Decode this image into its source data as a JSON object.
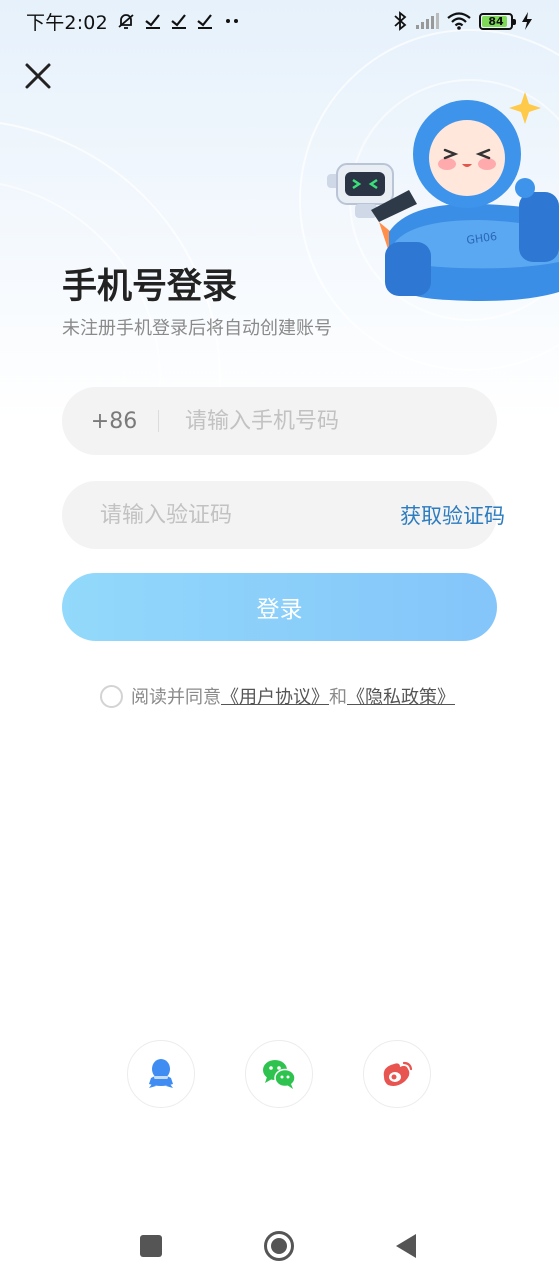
{
  "status_bar": {
    "time": "下午2:02",
    "battery_level": "84",
    "icons": [
      "mute-bell-icon",
      "check-icon",
      "check-icon",
      "check-icon",
      "more-dots-icon",
      "bluetooth-icon",
      "signal-icon",
      "wifi-icon",
      "battery-icon",
      "charging-icon"
    ]
  },
  "header": {
    "close_icon": "close-icon",
    "title": "手机号登录",
    "subtitle": "未注册手机登录后将自动创建账号"
  },
  "form": {
    "country_code": "+86",
    "phone_placeholder": "请输入手机号码",
    "phone_value": "",
    "code_placeholder": "请输入验证码",
    "code_value": "",
    "get_code_label": "获取验证码",
    "login_label": "登录"
  },
  "agreement": {
    "prefix": "阅读并同意",
    "user_agreement": "《用户协议》",
    "and": "和",
    "privacy_policy": "《隐私政策》",
    "checked": false
  },
  "third_party": [
    {
      "name": "qq",
      "icon": "qq-icon",
      "color": "#3f8cf2"
    },
    {
      "name": "wechat",
      "icon": "wechat-icon",
      "color": "#2ec24f"
    },
    {
      "name": "weibo",
      "icon": "weibo-icon",
      "color": "#e8544f"
    }
  ],
  "nav_bar": {
    "buttons": [
      "recent-apps-icon",
      "home-icon",
      "back-icon"
    ]
  },
  "colors": {
    "accent": "#2d7cc0",
    "login_gradient_start": "#92d9fb",
    "login_gradient_end": "#84c5fa",
    "field_bg": "#f3f3f3"
  }
}
